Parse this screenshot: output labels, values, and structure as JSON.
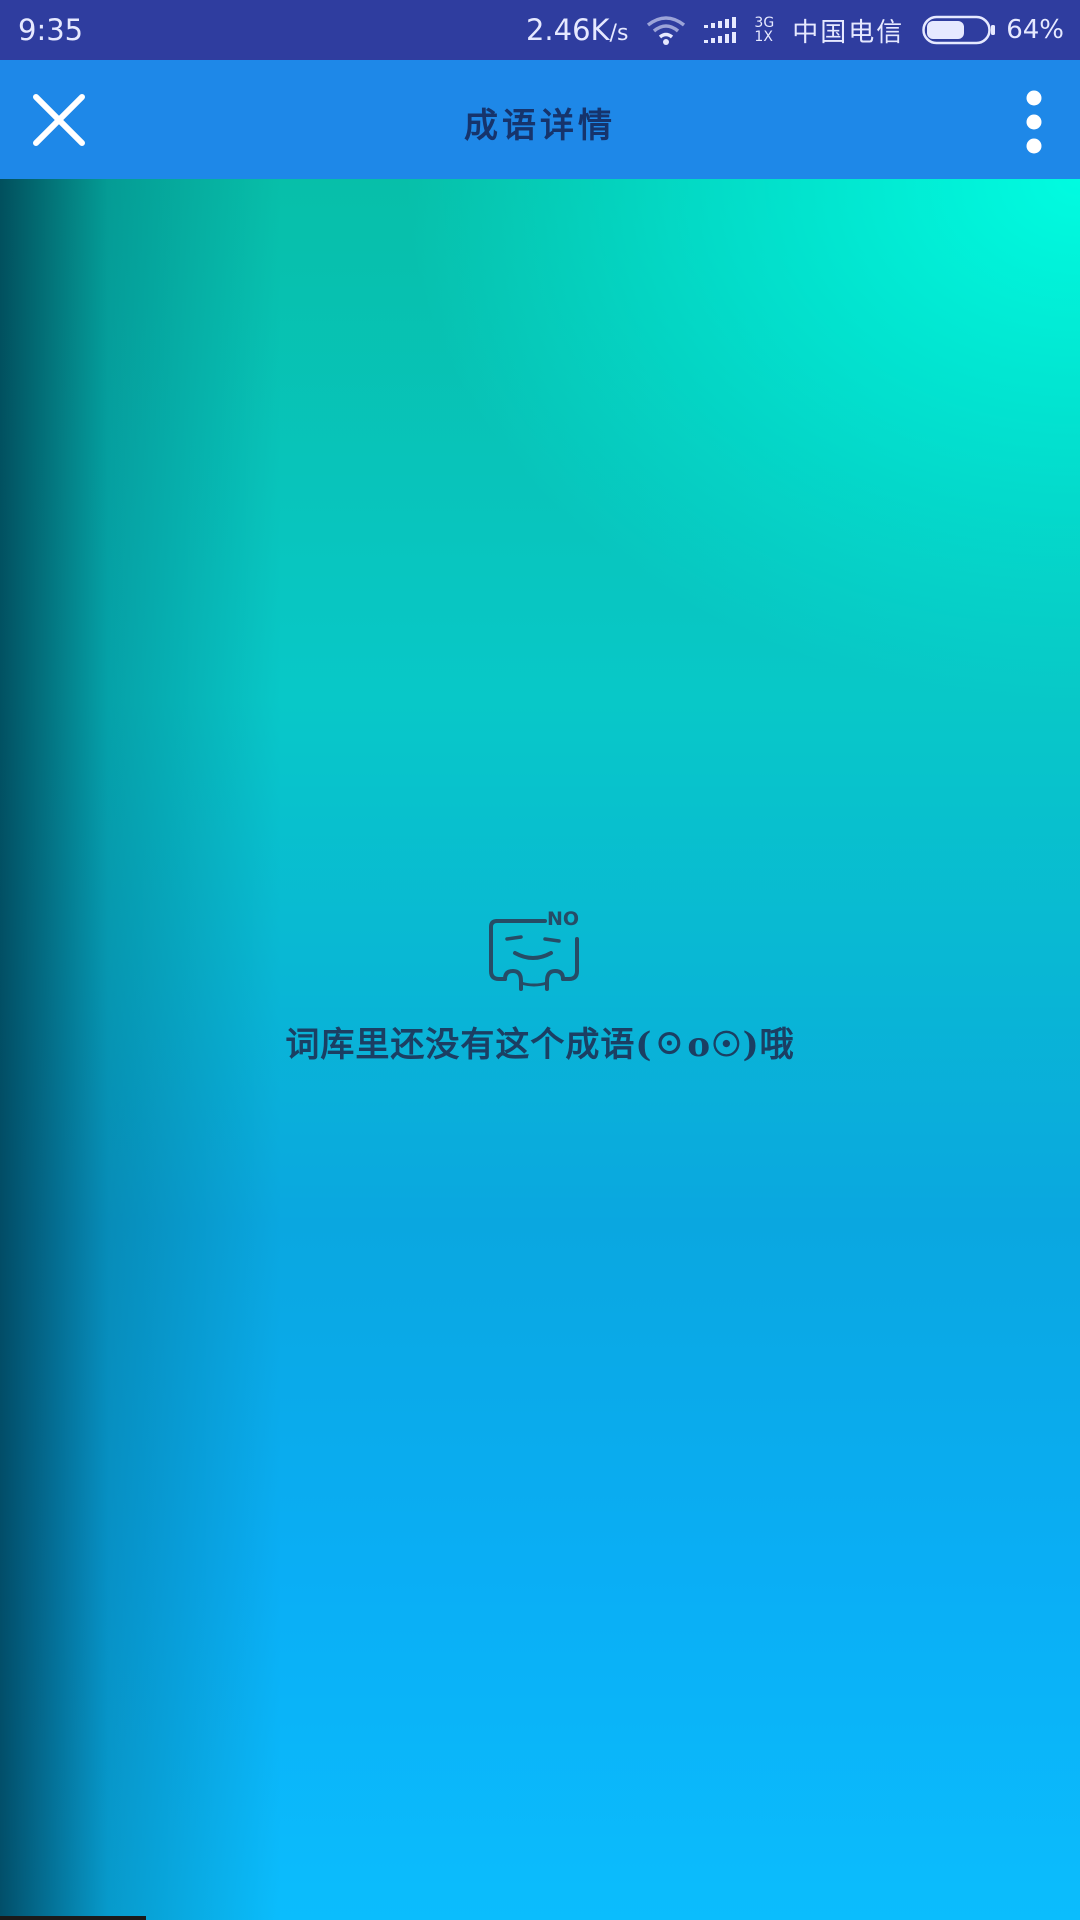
{
  "status_bar": {
    "time": "9:35",
    "net_speed": "2.46K",
    "net_speed_unit": "/s",
    "net_type_top": "3G",
    "net_type_bottom": "1X",
    "carrier": "中国电信",
    "battery_percent": "64%",
    "battery_level": 0.64
  },
  "app_bar": {
    "title": "成语详情",
    "close_icon": "close-icon",
    "overflow_icon": "more-vert-icon"
  },
  "empty_state": {
    "badge": "NO",
    "message": "词库里还没有这个成语(☉o☉)哦",
    "icon": "no-data-icon"
  },
  "colors": {
    "status_bar": "#2f3d9f",
    "app_bar": "#1e88e8",
    "title_text": "#16346c",
    "message_text": "#1b3f63"
  }
}
